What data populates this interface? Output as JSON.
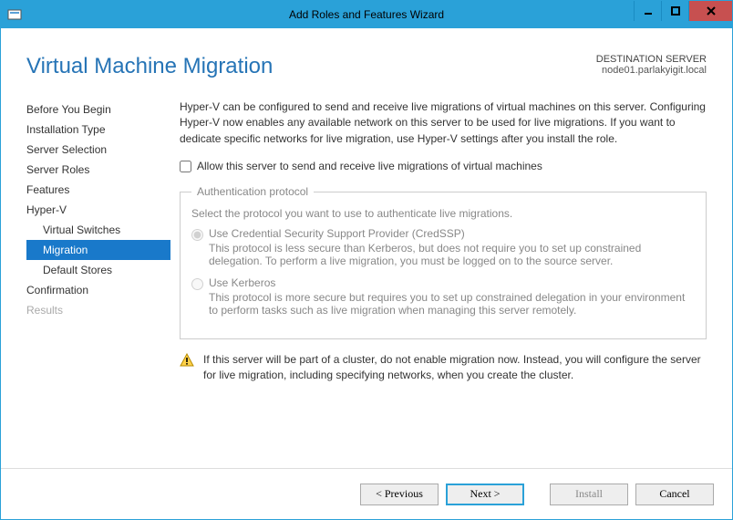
{
  "window": {
    "title": "Add Roles and Features Wizard"
  },
  "header": {
    "title": "Virtual Machine Migration",
    "destLabel": "DESTINATION SERVER",
    "destValue": "node01.parlakyigit.local"
  },
  "nav": [
    {
      "label": "Before You Begin",
      "indent": false,
      "selected": false,
      "disabled": false
    },
    {
      "label": "Installation Type",
      "indent": false,
      "selected": false,
      "disabled": false
    },
    {
      "label": "Server Selection",
      "indent": false,
      "selected": false,
      "disabled": false
    },
    {
      "label": "Server Roles",
      "indent": false,
      "selected": false,
      "disabled": false
    },
    {
      "label": "Features",
      "indent": false,
      "selected": false,
      "disabled": false
    },
    {
      "label": "Hyper-V",
      "indent": false,
      "selected": false,
      "disabled": false
    },
    {
      "label": "Virtual Switches",
      "indent": true,
      "selected": false,
      "disabled": false
    },
    {
      "label": "Migration",
      "indent": true,
      "selected": true,
      "disabled": false
    },
    {
      "label": "Default Stores",
      "indent": true,
      "selected": false,
      "disabled": false
    },
    {
      "label": "Confirmation",
      "indent": false,
      "selected": false,
      "disabled": false
    },
    {
      "label": "Results",
      "indent": false,
      "selected": false,
      "disabled": true
    }
  ],
  "main": {
    "description": "Hyper-V can be configured to send and receive live migrations of virtual machines on this server. Configuring Hyper-V now enables any available network on this server to be used for live migrations. If you want to dedicate specific networks for live migration, use Hyper-V settings after you install the role.",
    "checkboxLabel": "Allow this server to send and receive live migrations of virtual machines",
    "authSection": {
      "legend": "Authentication protocol",
      "desc": "Select the protocol you want to use to authenticate live migrations.",
      "options": [
        {
          "label": "Use Credential Security Support Provider (CredSSP)",
          "sub": "This protocol is less secure than Kerberos, but does not require you to set up constrained delegation. To perform a live migration, you must be logged on to the source server.",
          "checked": true
        },
        {
          "label": "Use Kerberos",
          "sub": "This protocol is more secure but requires you to set up constrained delegation in your environment to perform tasks such as live migration when managing this server remotely.",
          "checked": false
        }
      ]
    },
    "warning": "If this server will be part of a cluster, do not enable migration now. Instead, you will configure the server for live migration, including specifying networks, when you create the cluster."
  },
  "buttons": {
    "previous": "< Previous",
    "next": "Next >",
    "install": "Install",
    "cancel": "Cancel"
  }
}
